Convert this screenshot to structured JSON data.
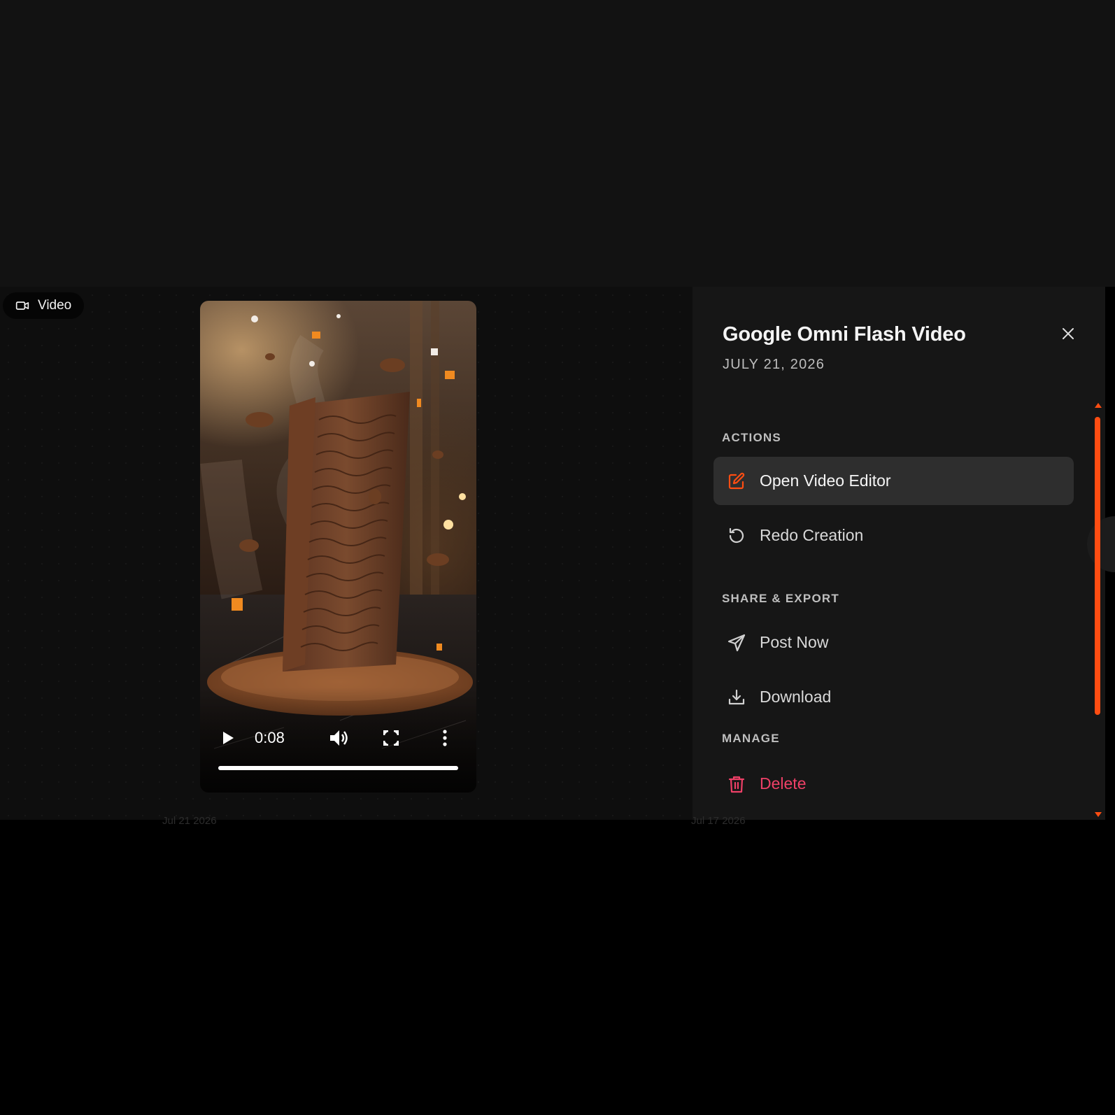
{
  "badge": {
    "label": "Video",
    "icon": "video-camera-icon"
  },
  "player": {
    "time": "0:08",
    "progress": 1.0,
    "icons": [
      "play-icon",
      "volume-icon",
      "fullscreen-icon",
      "more-vertical-icon"
    ]
  },
  "panel": {
    "title": "Google Omni Flash Video",
    "date": "JULY 21, 2026",
    "sections": {
      "actions": {
        "label": "ACTIONS",
        "items": [
          {
            "label": "Open Video Editor",
            "icon": "edit-icon",
            "active": true
          },
          {
            "label": "Redo Creation",
            "icon": "redo-icon"
          }
        ]
      },
      "share": {
        "label": "SHARE & EXPORT",
        "items": [
          {
            "label": "Post Now",
            "icon": "send-icon"
          },
          {
            "label": "Download",
            "icon": "download-icon"
          }
        ]
      },
      "manage": {
        "label": "MANAGE",
        "items": [
          {
            "label": "Delete",
            "icon": "trash-icon",
            "danger": true
          }
        ]
      }
    }
  },
  "background_row": {
    "date_left": "Jul 21 2026",
    "date_right": "Jul 17 2026"
  },
  "colors": {
    "accent": "#ff4d12",
    "danger": "#ee4067",
    "panel_bg": "#161616",
    "active_bg": "#2e2e2e"
  }
}
